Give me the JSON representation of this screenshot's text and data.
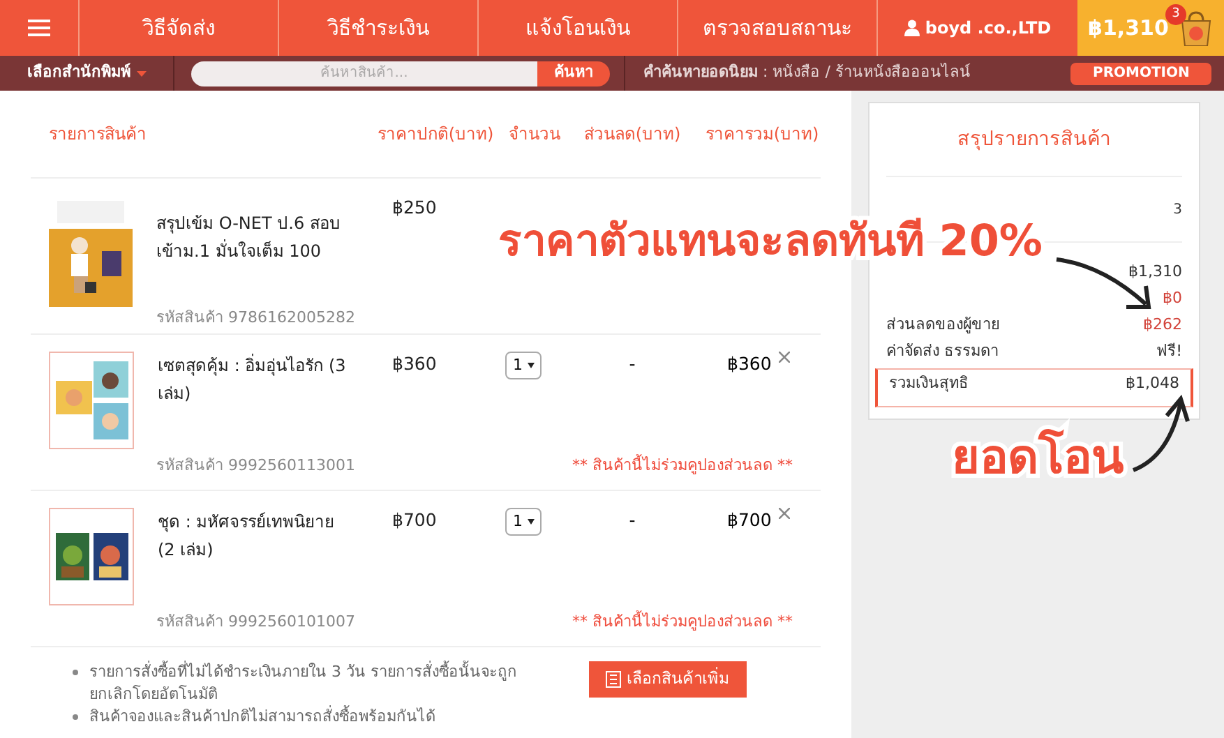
{
  "header": {
    "nav": [
      "วิธีจัดส่ง",
      "วิธีชำระเงิน",
      "แจ้งโอนเงิน",
      "ตรวจสอบสถานะ"
    ],
    "user": "boyd .co.,LTD",
    "cart_total": "฿1,310",
    "cart_count": "3"
  },
  "subbar": {
    "publisher_select": "เลือกสำนักพิมพ์",
    "search": {
      "placeholder": "ค้นหาสินค้า..."
    },
    "search_button": "ค้นหา",
    "popular": "**คำค้นหายอดนิยม** : หนังสือ / ร้านหนังสือออนไลน์",
    "promotion": "PROMOTION"
  },
  "cart": {
    "columns": [
      "รายการสินค้า",
      "ราคาปกติ(บาท)",
      "จำนวน",
      "ส่วนลด(บาท)",
      "ราคารวม(บาท)"
    ],
    "items": [
      {
        "kind": "plain",
        "title": "สรุปเข้ม O-NET ป.6 สอบเข้าม.1 มั่นใจเต็ม 100",
        "code": "รหัสสินค้า 9786162005282",
        "price": "฿250"
      },
      {
        "kind": "full",
        "title": "เซตสุดคุ้ม : อิ่มอุ่นไอรัก (3 เล่ม)",
        "code": "รหัสสินค้า 9992560113001",
        "price": "฿360",
        "quantity": "1",
        "discount": "-",
        "total": "฿360",
        "note": "** สินค้านี้ไม่ร่วมคูปองส่วนลด **"
      },
      {
        "kind": "full",
        "title": "ชุด : มหัศจรรย์เทพนิยาย (2 เล่ม)",
        "code": "รหัสสินค้า 9992560101007",
        "price": "฿700",
        "quantity": "1",
        "discount": "-",
        "total": "฿700",
        "note": "** สินค้านี้ไม่ร่วมคูปองส่วนลด **"
      }
    ],
    "notes": [
      "รายการสั่งซื้อที่ไม่ได้ชำระเงินภายใน 3 วัน รายการสั่งซื้อนั้นจะถูกยกเลิกโดยอัตโนมัติ",
      "สินค้าจองและสินค้าปกติไม่สามารถสั่งซื้อพร้อมกันได้"
    ],
    "more_button": "เลือกสินค้าเพิ่ม"
  },
  "summary": {
    "title": "สรุปรายการสินค้า",
    "count": "3",
    "rows": [
      {
        "value": "฿1,310",
        "highlighted": false
      },
      {
        "value": "฿0",
        "highlighted": true
      },
      {
        "label": "ส่วนลดของผู้ขาย",
        "value": "฿262",
        "highlighted": true
      },
      {
        "label": "ค่าจัดส่ง ธรรมดา",
        "value": "ฟรี!",
        "highlighted": false
      }
    ],
    "total": {
      "label": "รวมเงินสุทธิ",
      "value": "฿1,048"
    }
  },
  "annotations": [
    {
      "text": "ราคาตัวแทนจะลดทันที 20%"
    },
    {
      "text": "ยอดโอน"
    }
  ]
}
